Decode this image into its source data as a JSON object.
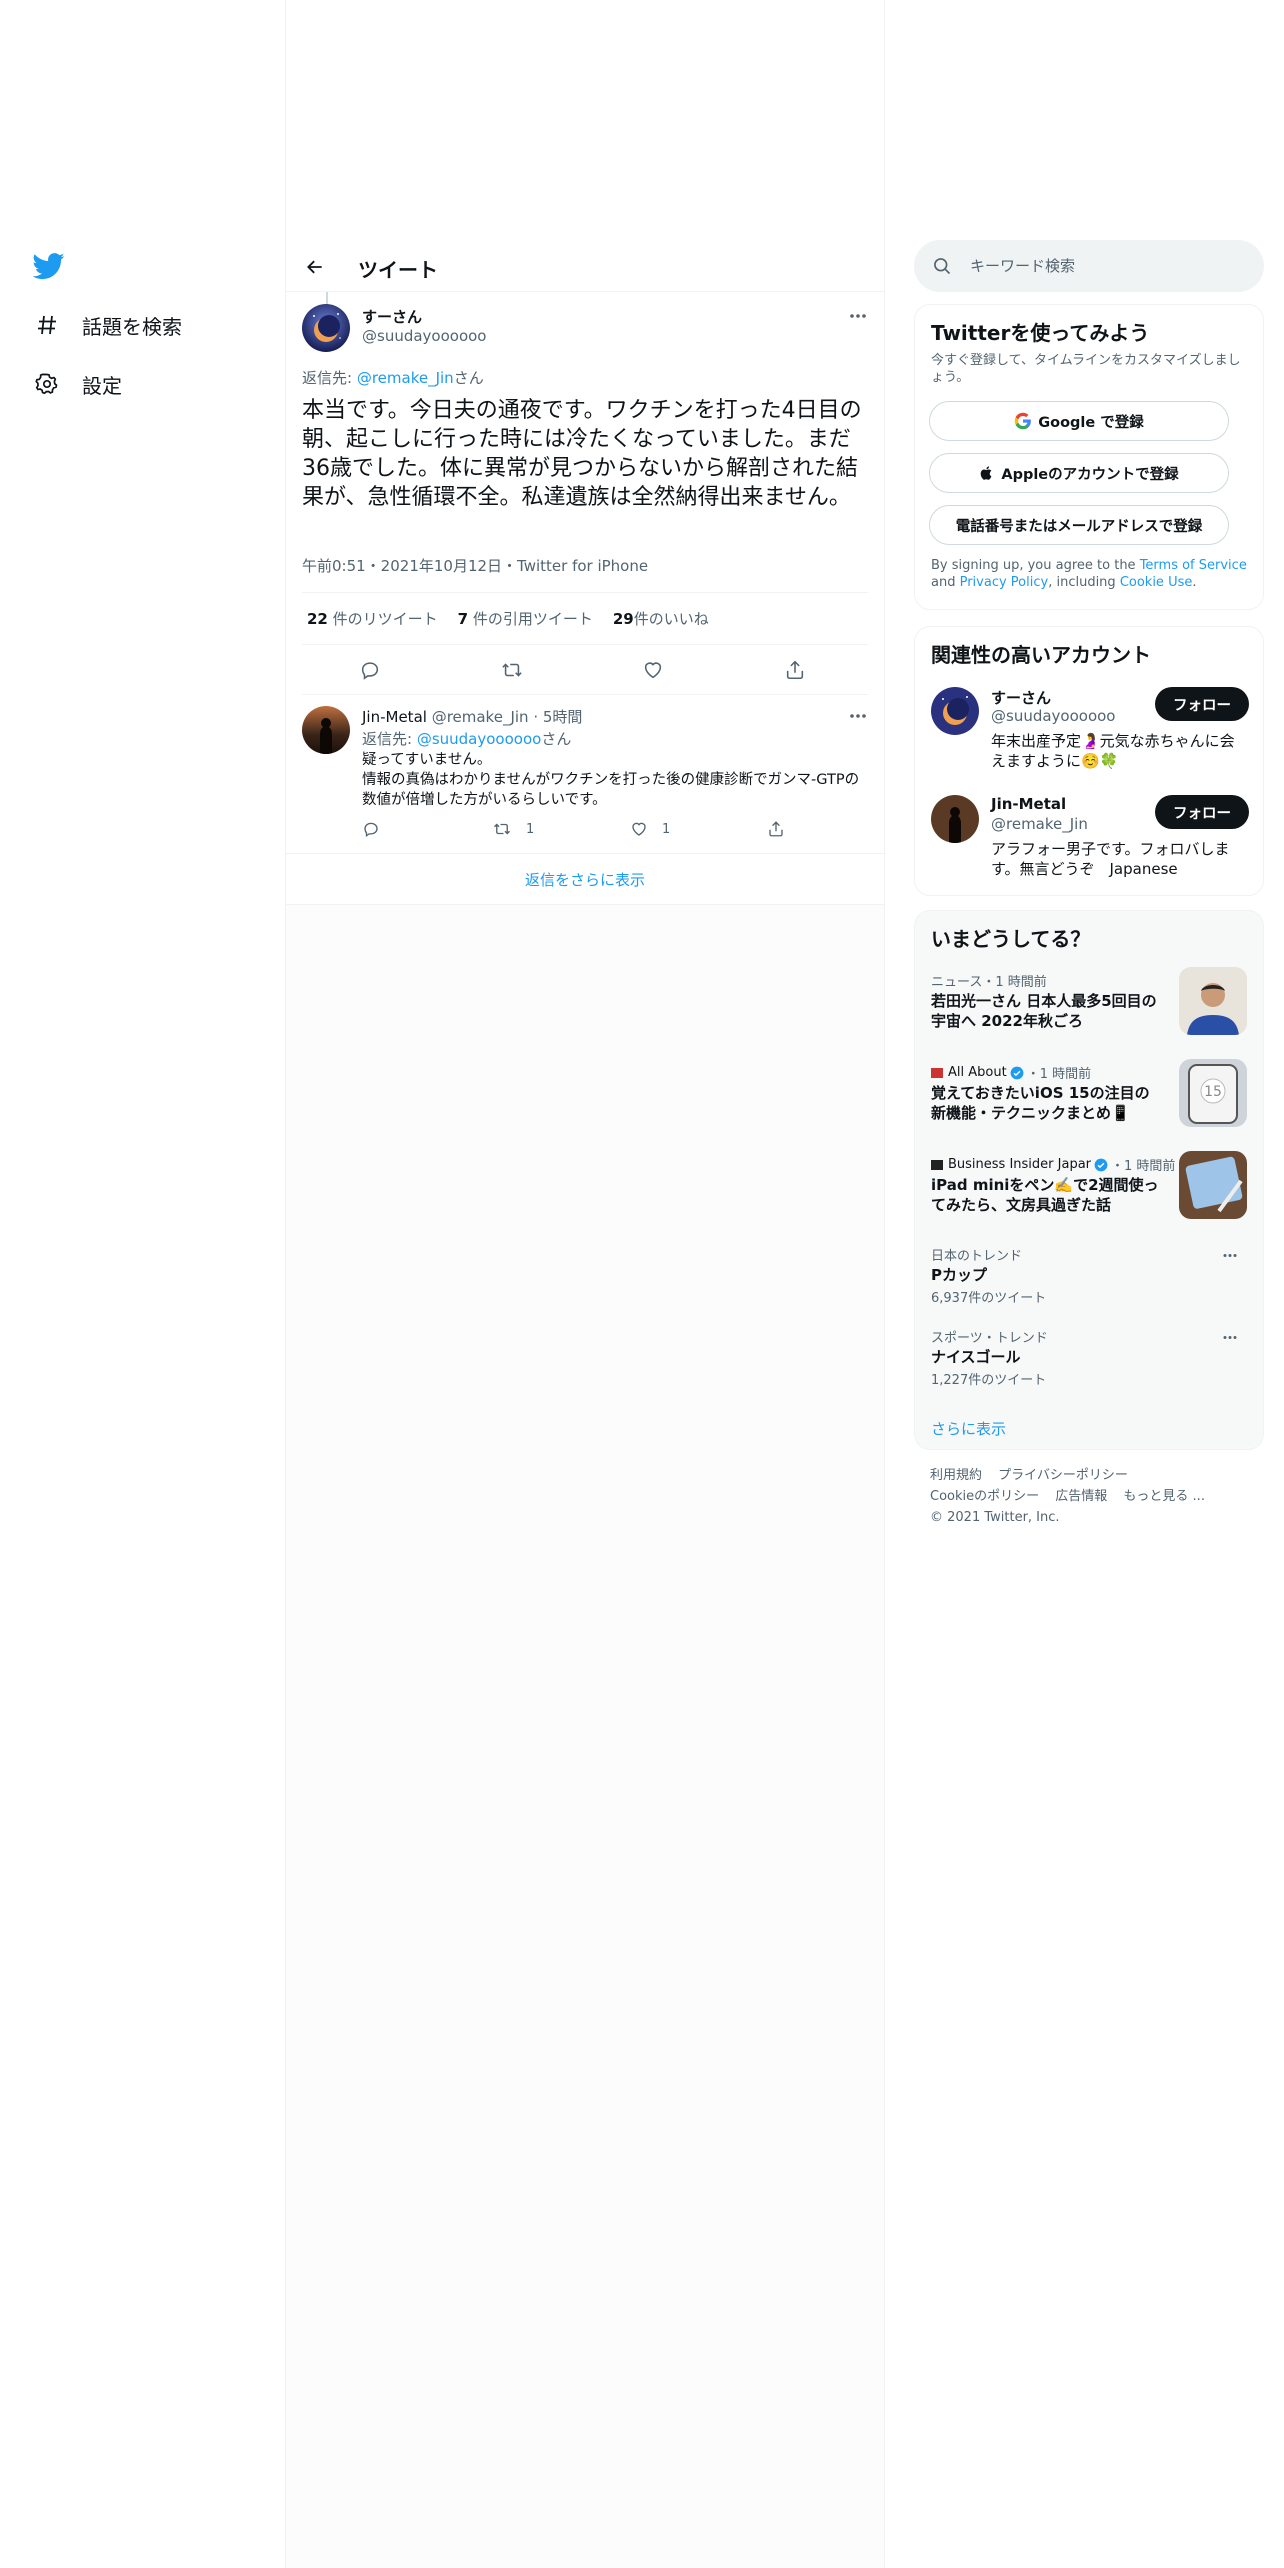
{
  "nav": {
    "items": [
      {
        "label": "話題を検索",
        "icon": "hashtag-icon"
      },
      {
        "label": "設定",
        "icon": "gear-icon"
      }
    ]
  },
  "header": {
    "title": "ツイート"
  },
  "tweet": {
    "name": "すーさん",
    "handle": "@suudayoooooo",
    "reply_prefix": "返信先: ",
    "reply_handle": "@remake_Jin",
    "reply_suffix": "さん",
    "text": "本当です。今日夫の通夜です。ワクチンを打った4日目の朝、起こしに行った時には冷たくなっていました。まだ36歳でした。体に異常が見つからないから解剖された結果が、急性循環不全。私達遺族は全然納得出来ません。",
    "meta": "午前0:51・2021年10月12日・Twitter for iPhone",
    "stats": {
      "retweets": "22",
      "retweets_label": " 件のリツイート",
      "quotes": "7",
      "quotes_label": " 件の引用ツイート",
      "likes": "29",
      "likes_label": "件のいいね"
    }
  },
  "reply": {
    "name": "Jin-Metal",
    "handle": " @remake_Jin",
    "time": " · 5時間",
    "reply_prefix": "返信先: ",
    "reply_handle": "@suudayoooooo",
    "reply_suffix": "さん",
    "line1": "疑ってすいません。",
    "line2": "情報の真偽はわかりませんがワクチンを打った後の健康診断でガンマ-GTPの数値が倍増した方がいるらしいです。",
    "retweets": "1",
    "likes": "1"
  },
  "show_more_replies": "返信をさらに表示",
  "search": {
    "placeholder": "キーワード検索"
  },
  "signup": {
    "title": "Twitterを使ってみよう",
    "desc": "今すぐ登録して、タイムラインをカスタマイズしましょう。",
    "google": "Google で登録",
    "apple": "Appleのアカウントで登録",
    "phone": "電話番号またはメールアドレスで登録",
    "terms_1": "By signing up, you agree to the ",
    "terms_link1": "Terms of Service",
    "terms_2": " and ",
    "terms_link2": "Privacy Policy",
    "terms_3": ", including ",
    "terms_link3": "Cookie Use",
    "terms_4": "."
  },
  "relevant": {
    "title": "関連性の高いアカウント",
    "follow_label": "フォロー",
    "accounts": [
      {
        "name": "すーさん",
        "handle": "@suudayoooooo",
        "bio": "年末出産予定🤰元気な赤ちゃんに会えますように☺️🍀"
      },
      {
        "name": "Jin-Metal",
        "handle": "@remake_Jin",
        "bio": "アラフォー男子です。フォロバします。無言どうぞ　Japanese"
      }
    ]
  },
  "trends": {
    "title": "いまどうしてる？",
    "items": [
      {
        "meta": "ニュース・1 時間前",
        "title": "若田光一さん 日本人最多5回目の宇宙へ 2022年秋ごろ"
      },
      {
        "source": "All About",
        "meta": "・1 時間前",
        "title": "覚えておきたいiOS 15の注目の新機能・テクニックまとめ📱"
      },
      {
        "source": "Business Insider Japar",
        "meta": "・1 時間前",
        "title": "iPad miniをペン✍️で2週間使ってみたら、文房具過ぎた話"
      },
      {
        "meta": "日本のトレンド",
        "title": "Pカップ",
        "count": "6,937件のツイート"
      },
      {
        "meta": "スポーツ・トレンド",
        "title": "ナイスゴール",
        "count": "1,227件のツイート"
      }
    ],
    "show_more": "さらに表示"
  },
  "footer": {
    "links": [
      "利用規約",
      "プライバシーポリシー",
      "Cookieのポリシー",
      "広告情報",
      "もっと見る ..."
    ],
    "copyright": "© 2021 Twitter, Inc."
  },
  "colors": {
    "accent": "#1d9bf0",
    "text": "#0f1419",
    "muted": "#536471",
    "border": "#eff3f4"
  }
}
